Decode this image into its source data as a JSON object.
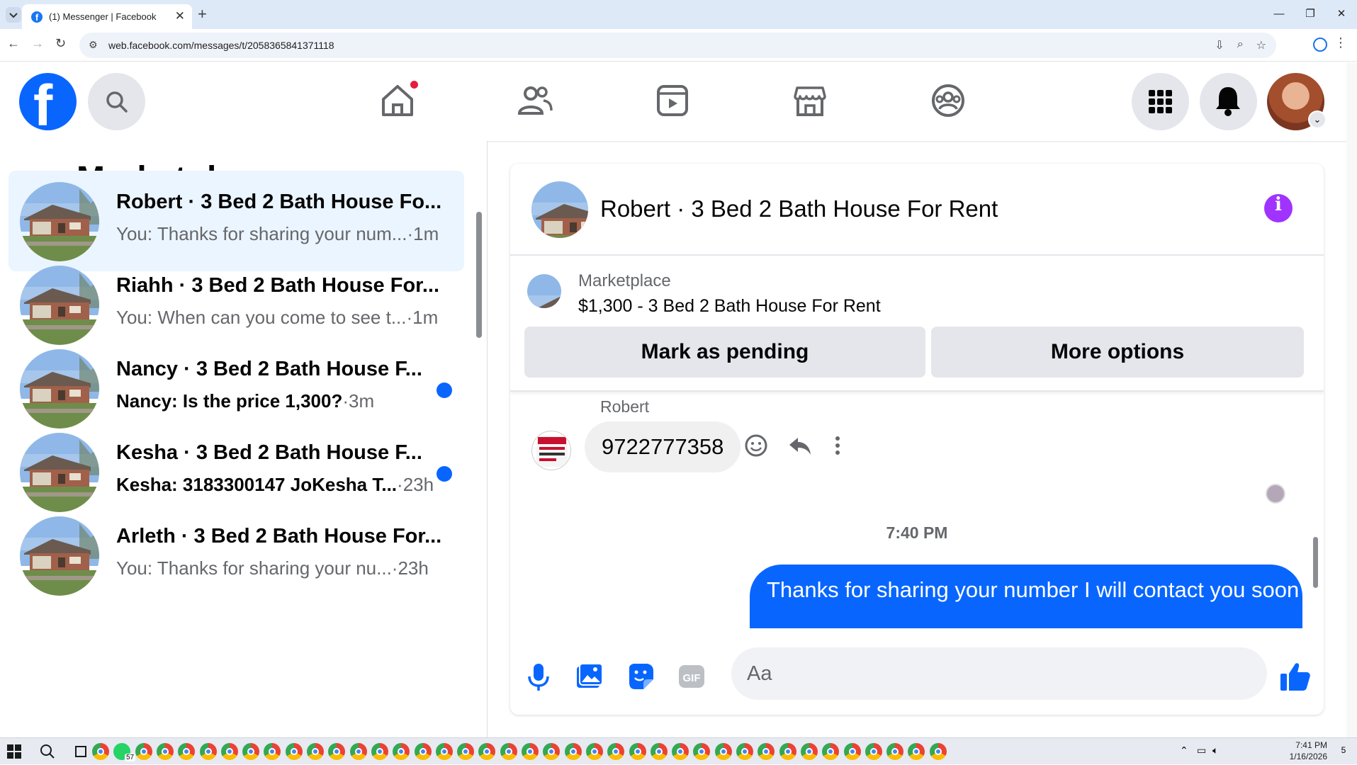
{
  "browser": {
    "tab_title": "(1) Messenger | Facebook",
    "tab_favicon": "f",
    "new_tab": "+",
    "url": "web.facebook.com/messages/t/2058365841371118",
    "window_controls": [
      "—",
      "❐",
      "✕"
    ]
  },
  "header": {
    "logo_letter": "f",
    "nav_icons": [
      "home-icon",
      "friends-icon",
      "video-icon",
      "marketplace-icon",
      "groups-icon"
    ],
    "home_notification": true
  },
  "left": {
    "title": "Marketplace",
    "back": "←",
    "conversations": [
      {
        "name": "Robert · 3 Bed 2 Bath House Fo...",
        "preview": "You: Thanks for sharing your num...",
        "time": "·1m",
        "unread": false,
        "active": true
      },
      {
        "name": "Riahh · 3 Bed 2 Bath House For...",
        "preview": "You: When can you come to see t...",
        "time": "·1m",
        "unread": false,
        "active": false
      },
      {
        "name": "Nancy · 3 Bed 2 Bath House F...",
        "preview": "Nancy: Is the price 1,300?",
        "time": "·3m",
        "unread": true,
        "active": false
      },
      {
        "name": "Kesha · 3 Bed 2 Bath House F...",
        "preview": "Kesha: 3183300147 JoKesha T...",
        "time": "·23h",
        "unread": true,
        "active": false
      },
      {
        "name": "Arleth · 3 Bed 2 Bath House For...",
        "preview": "You: Thanks for sharing your nu...",
        "time": "·23h",
        "unread": false,
        "active": false
      }
    ]
  },
  "chat": {
    "title": "Robert · 3 Bed 2 Bath House For Rent",
    "info": "i",
    "listing_label": "Marketplace",
    "listing_item": "$1,300 - 3 Bed 2 Bath House For Rent",
    "mark_pending": "Mark as pending",
    "more_options": "More options",
    "sender_name": "Robert",
    "incoming_message": "9722777358",
    "timestamp": "7:40 PM",
    "outgoing_message": "Thanks for sharing your number I will contact you soon",
    "composer_placeholder": "Aa",
    "gif_label": "GIF"
  },
  "taskbar": {
    "time": "7:41 PM",
    "date": "1/16/2026",
    "whatsapp_badge": "57",
    "notifications": "5"
  },
  "colors": {
    "brand_blue": "#0866ff",
    "active_row": "#ebf5ff",
    "info_purple": "#a033ff",
    "unread_dot": "#0866ff",
    "notif_red": "#e41e3f"
  }
}
